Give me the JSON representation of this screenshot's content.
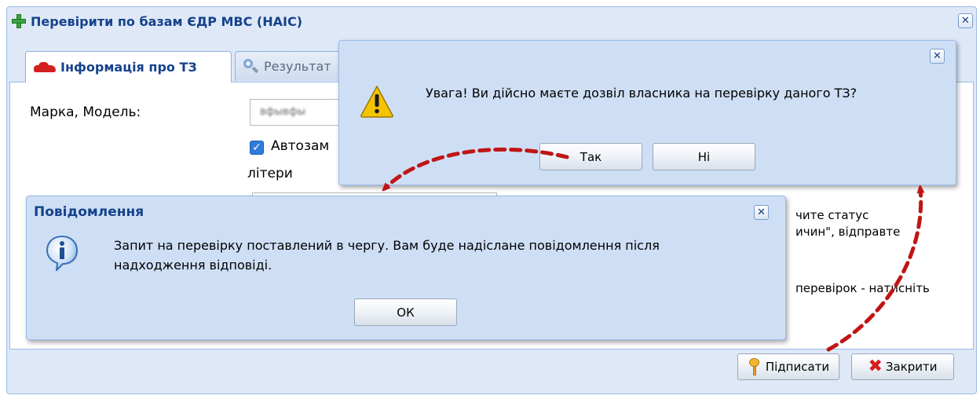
{
  "main_window": {
    "title": "Перевірити по базам ЄДР МВС (НАІС)",
    "close_glyph": "✕",
    "tabs": [
      {
        "label": "Інформація про ТЗ",
        "icon": "car-icon",
        "active": true
      },
      {
        "label": "Результат",
        "icon": "magnifier-icon",
        "active": false
      }
    ],
    "form": {
      "brand_model_label": "Марка, Модель:",
      "brand_model_value": "вфывфы",
      "autoreplace_checked": true,
      "autoreplace_label": "Автозам",
      "letters_label": "літери",
      "right_text_1": "чите статус",
      "right_text_2": "ичин\", відправте",
      "right_text_3": "перевірок - натисніть"
    },
    "buttons": {
      "sign": "Підписати",
      "close": "Закрити"
    }
  },
  "confirm_dialog": {
    "close_glyph": "✕",
    "message": "Увага! Ви дійсно маєте дозвіл власника на перевірку даного ТЗ?",
    "yes_label": "Так",
    "no_label": "Ні",
    "icon": "warning-icon"
  },
  "info_dialog": {
    "title": "Повідомлення",
    "close_glyph": "✕",
    "message_line1": "Запит на перевірку поставлений в чергу. Вам буде надіслане повідомлення після",
    "message_line2": "надходження відповіді.",
    "ok_label": "ОК",
    "icon": "info-icon"
  },
  "colors": {
    "title_blue": "#15428b",
    "window_bg": "#dfe8f6",
    "dialog_bg": "#cedff5",
    "arrow_red": "#c01515"
  }
}
